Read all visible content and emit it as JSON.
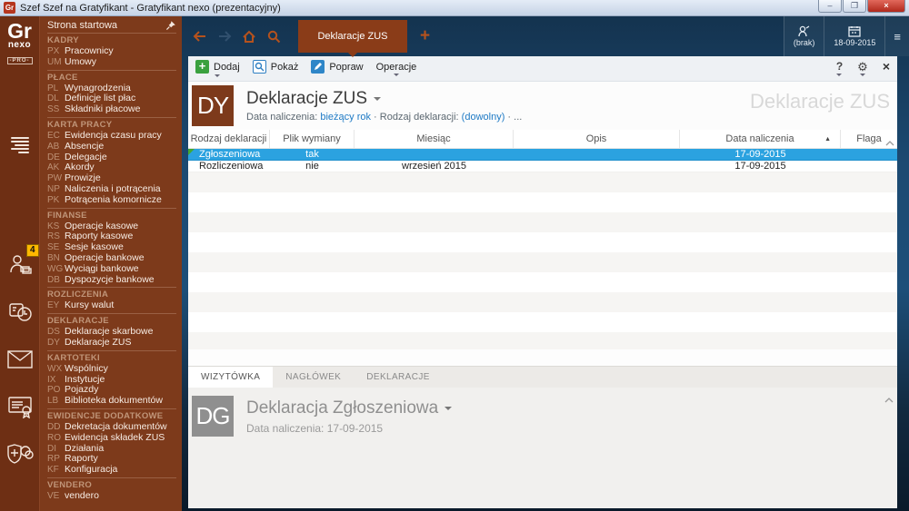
{
  "window": {
    "title": "Szef Szef na Gratyfikant - Gratyfikant nexo (prezentacyjny)",
    "icon_text": "Gr",
    "minimize_glyph": "–",
    "maximize_glyph": "❐",
    "close_glyph": "×"
  },
  "sidebar": {
    "logo": {
      "gr": "Gr",
      "nexo": "nexo",
      "pro": "-PRO-"
    },
    "notification_badge": "4",
    "home_item": "Strona startowa",
    "sections": [
      {
        "title": "KADRY",
        "items": [
          {
            "code": "PX",
            "label": "Pracownicy"
          },
          {
            "code": "UM",
            "label": "Umowy"
          }
        ]
      },
      {
        "title": "PŁACE",
        "items": [
          {
            "code": "PL",
            "label": "Wynagrodzenia"
          },
          {
            "code": "DL",
            "label": "Definicje list płac"
          },
          {
            "code": "SS",
            "label": "Składniki płacowe"
          }
        ]
      },
      {
        "title": "KARTA PRACY",
        "items": [
          {
            "code": "EC",
            "label": "Ewidencja czasu pracy"
          },
          {
            "code": "AB",
            "label": "Absencje"
          },
          {
            "code": "DE",
            "label": "Delegacje"
          },
          {
            "code": "AK",
            "label": "Akordy"
          },
          {
            "code": "PW",
            "label": "Prowizje"
          },
          {
            "code": "NP",
            "label": "Naliczenia i potrącenia"
          },
          {
            "code": "PK",
            "label": "Potrącenia komornicze"
          }
        ]
      },
      {
        "title": "FINANSE",
        "items": [
          {
            "code": "KS",
            "label": "Operacje kasowe"
          },
          {
            "code": "RS",
            "label": "Raporty kasowe"
          },
          {
            "code": "SE",
            "label": "Sesje kasowe"
          },
          {
            "code": "BN",
            "label": "Operacje bankowe"
          },
          {
            "code": "WG",
            "label": "Wyciągi bankowe"
          },
          {
            "code": "DB",
            "label": "Dyspozycje bankowe"
          }
        ]
      },
      {
        "title": "ROZLICZENIA",
        "items": [
          {
            "code": "EY",
            "label": "Kursy walut"
          }
        ]
      },
      {
        "title": "DEKLARACJE",
        "items": [
          {
            "code": "DS",
            "label": "Deklaracje skarbowe"
          },
          {
            "code": "DY",
            "label": "Deklaracje ZUS"
          }
        ]
      },
      {
        "title": "KARTOTEKI",
        "items": [
          {
            "code": "WX",
            "label": "Wspólnicy"
          },
          {
            "code": "IX",
            "label": "Instytucje"
          },
          {
            "code": "PO",
            "label": "Pojazdy"
          },
          {
            "code": "LB",
            "label": "Biblioteka dokumentów"
          }
        ]
      },
      {
        "title": "EWIDENCJE DODATKOWE",
        "items": [
          {
            "code": "DD",
            "label": "Dekretacja dokumentów"
          },
          {
            "code": "RO",
            "label": "Ewidencja składek ZUS"
          },
          {
            "code": "DI",
            "label": "Działania"
          },
          {
            "code": "RP",
            "label": "Raporty"
          },
          {
            "code": "KF",
            "label": "Konfiguracja"
          }
        ]
      },
      {
        "title": "VENDERO",
        "items": [
          {
            "code": "VE",
            "label": "vendero"
          }
        ]
      }
    ]
  },
  "navbar": {
    "active_tab": "Deklaracje ZUS",
    "user_label": "(brak)",
    "date_label": "18-09-2015",
    "burger_glyph": "≡"
  },
  "toolbar": {
    "add_label": "Dodaj",
    "show_label": "Pokaż",
    "edit_label": "Popraw",
    "operations_label": "Operacje",
    "help_glyph": "?",
    "gear_glyph": "⚙",
    "close_glyph": "×"
  },
  "header": {
    "badge": "DY",
    "title": "Deklaracje ZUS",
    "filter_label_1": "Data naliczenia:",
    "filter_value_1": "bieżący rok",
    "filter_sep_1": "·",
    "filter_label_2": "Rodzaj deklaracji:",
    "filter_value_2": "(dowolny)",
    "filter_sep_2": "·",
    "filter_more": "...",
    "watermark": "Deklaracje ZUS"
  },
  "table": {
    "columns": [
      {
        "label": "Rodzaj deklaracji"
      },
      {
        "label": "Plik wymiany"
      },
      {
        "label": "Miesiąc"
      },
      {
        "label": "Opis"
      },
      {
        "label": "Data naliczenia",
        "sort": "asc"
      },
      {
        "label": "Flaga"
      }
    ],
    "rows": [
      {
        "selected": true,
        "cells": [
          "Zgłoszeniowa",
          "tak",
          "",
          "",
          "17-09-2015",
          ""
        ]
      },
      {
        "selected": false,
        "cells": [
          "Rozliczeniowa",
          "nie",
          "wrzesień 2015",
          "",
          "17-09-2015",
          ""
        ]
      }
    ]
  },
  "bottom": {
    "tabs": [
      {
        "label": "WIZYTÓWKA",
        "active": true
      },
      {
        "label": "NAGŁÓWEK",
        "active": false
      },
      {
        "label": "DEKLARACJE",
        "active": false
      }
    ],
    "badge": "DG",
    "title": "Deklaracja Zgłoszeniowa",
    "subtitle": "Data naliczenia: 17-09-2015"
  }
}
